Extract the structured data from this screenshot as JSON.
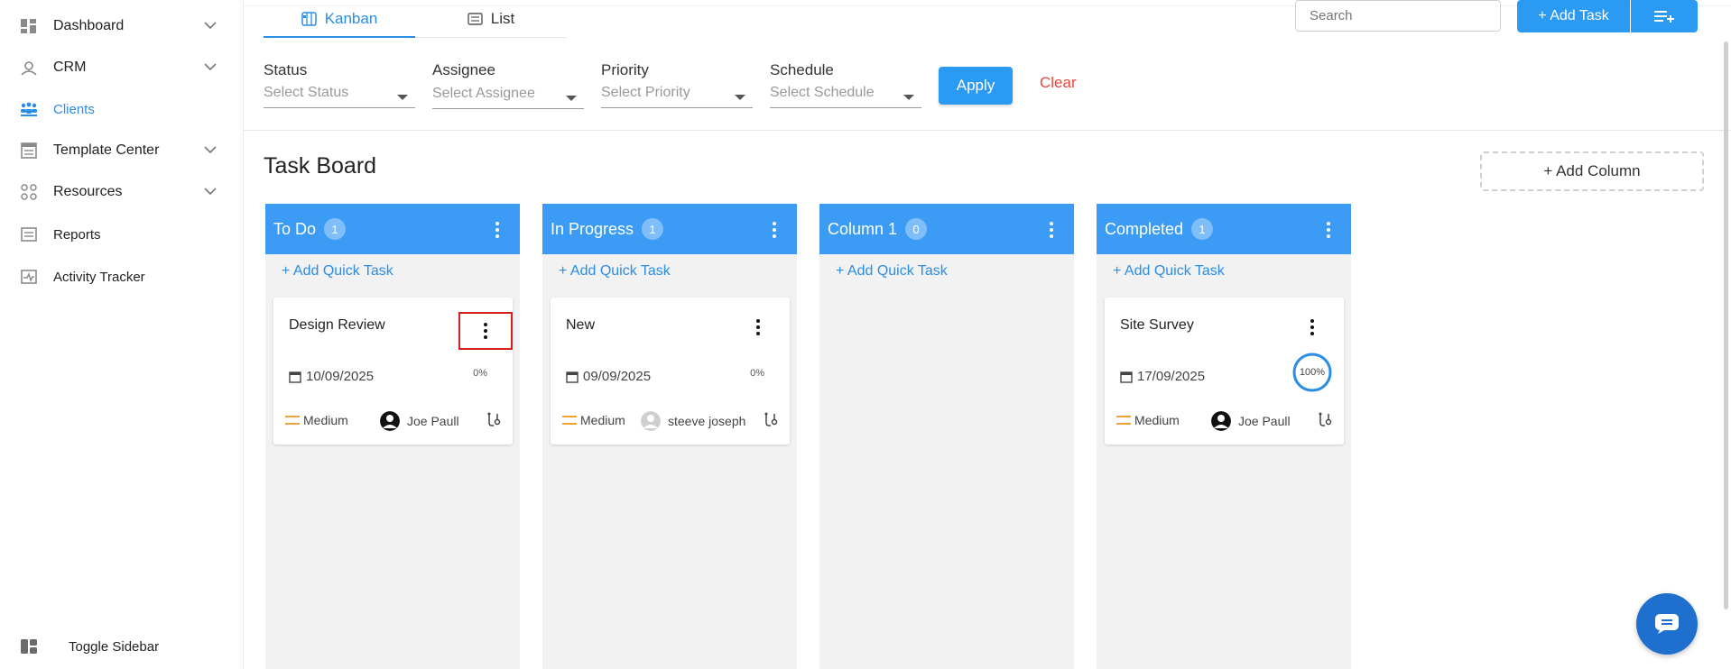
{
  "sidebar": {
    "items": [
      {
        "label": "Dashboard",
        "icon": "dashboard-icon",
        "expandable": true
      },
      {
        "label": "CRM",
        "icon": "crm-icon",
        "expandable": true
      },
      {
        "label": "Clients",
        "icon": "clients-icon",
        "active": true
      },
      {
        "label": "Template Center",
        "icon": "template-icon",
        "expandable": true
      },
      {
        "label": "Resources",
        "icon": "resources-icon",
        "expandable": true
      },
      {
        "label": "Reports",
        "icon": "reports-icon"
      },
      {
        "label": "Activity Tracker",
        "icon": "activity-icon"
      }
    ],
    "toggle_label": "Toggle Sidebar"
  },
  "tabs": {
    "kanban": "Kanban",
    "list": "List"
  },
  "search": {
    "placeholder": "Search"
  },
  "toolbar": {
    "add_task_label": "+ Add Task"
  },
  "filters": {
    "status": {
      "label": "Status",
      "placeholder": "Select Status"
    },
    "assignee": {
      "label": "Assignee",
      "placeholder": "Select Assignee"
    },
    "priority": {
      "label": "Priority",
      "placeholder": "Select Priority"
    },
    "schedule": {
      "label": "Schedule",
      "placeholder": "Select Schedule"
    },
    "apply_label": "Apply",
    "clear_label": "Clear"
  },
  "board": {
    "title": "Task Board",
    "add_column_label": "+ Add Column",
    "quick_add_label": "+ Add Quick Task",
    "columns": [
      {
        "title": "To Do",
        "count": "1",
        "card": {
          "title": "Design Review",
          "date": "10/09/2025",
          "progress": "0%",
          "progress_value": 0,
          "priority": "Medium",
          "assignee": "Joe Paull"
        }
      },
      {
        "title": "In Progress",
        "count": "1",
        "card": {
          "title": "New",
          "date": "09/09/2025",
          "progress": "0%",
          "progress_value": 0,
          "priority": "Medium",
          "assignee": "steeve joseph"
        }
      },
      {
        "title": "Column 1",
        "count": "0"
      },
      {
        "title": "Completed",
        "count": "1",
        "card": {
          "title": "Site Survey",
          "date": "17/09/2025",
          "progress": "100%",
          "progress_value": 100,
          "priority": "Medium",
          "assignee": "Joe Paull"
        }
      }
    ]
  },
  "colors": {
    "accent": "#2b9af3",
    "column_header": "#3b9bf5",
    "danger": "#e8453c",
    "priority_medium": "#f0a23a",
    "chat_button": "#1f6fcf"
  }
}
